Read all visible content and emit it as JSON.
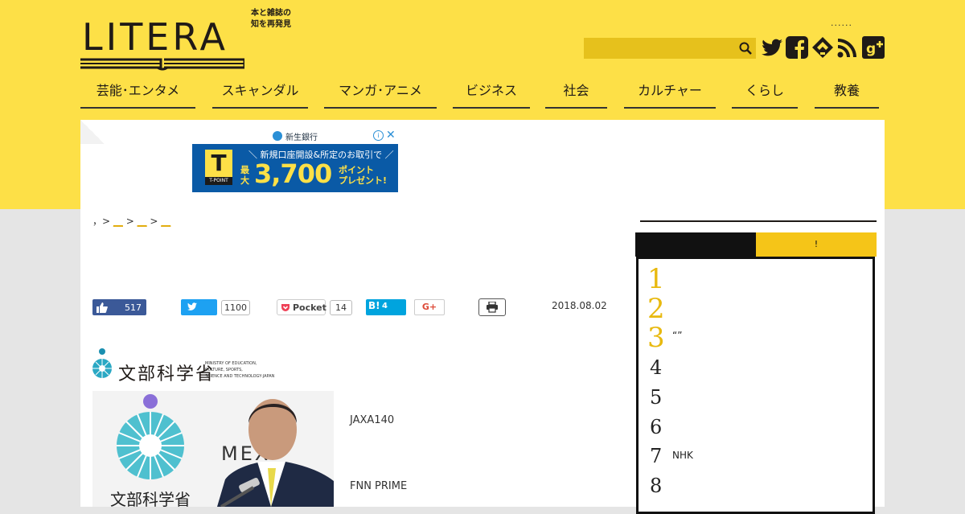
{
  "header": {
    "logo_text": "LITERA",
    "tagline_line1": "本と雑誌の",
    "tagline_line2": "知を再発見",
    "dots": "......",
    "search_placeholder": ""
  },
  "nav": {
    "items": [
      {
        "label": "芸能･エンタメ"
      },
      {
        "label": "スキャンダル"
      },
      {
        "label": "マンガ･アニメ"
      },
      {
        "label": "ビジネス"
      },
      {
        "label": "社会"
      },
      {
        "label": "カルチャー"
      },
      {
        "label": "くらし"
      },
      {
        "label": "教養"
      }
    ]
  },
  "ad": {
    "bank": "新生銀行",
    "line1": "＼ 新規口座開設&所定のお取引で ／",
    "saidai": "最大",
    "amount": "3,700",
    "pt1": "ポイント",
    "pt2": "プレゼント!",
    "tpoint": "T-POINT",
    "tlogo": "T"
  },
  "breadcrumb": {
    "sep": "，>",
    "items": [
      "__",
      "__",
      "__"
    ]
  },
  "share": {
    "fb_count": "517",
    "tw_count": "1100",
    "pocket_label": "Pocket",
    "pocket_count": "14",
    "hatena_label": "B!",
    "hatena_count": "4",
    "gplus_label": "G+"
  },
  "article": {
    "date": "2018.08.02",
    "para1": "JAXA140",
    "para2": "FNN PRIME"
  },
  "mext": {
    "name": "文部科学省",
    "en1": "MINISTRY OF EDUCATION,",
    "en2": "CULTURE, SPORTS,",
    "en3": "SCIENCE AND TECHNOLOGY-JAPAN",
    "photo_name": "文部科学省",
    "photo_mext": "MEX"
  },
  "sidebar": {
    "tab2_label": "!",
    "ranks": [
      {
        "num": "1",
        "title": ""
      },
      {
        "num": "2",
        "title": ""
      },
      {
        "num": "3",
        "title": "“”"
      },
      {
        "num": "4",
        "title": ""
      },
      {
        "num": "5",
        "title": ""
      },
      {
        "num": "6",
        "title": ""
      },
      {
        "num": "7",
        "title": "NHK"
      },
      {
        "num": "8",
        "title": ""
      }
    ]
  },
  "colors": {
    "brand_yellow": "#fde047",
    "rank_gold": "#e8b90f",
    "text_dark": "#1f1a17"
  }
}
